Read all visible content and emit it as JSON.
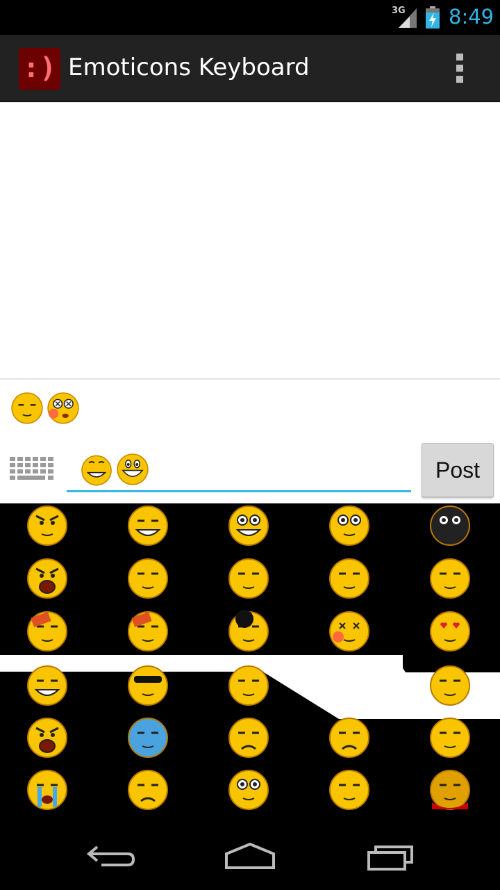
{
  "status_bar": {
    "network": "3G",
    "time": "8:49",
    "accent": "#33b5e5"
  },
  "action_bar": {
    "title": "Emoticons Keyboard",
    "icon_glyph": ":)",
    "overflow_icon": "more-vert-icon"
  },
  "preview": {
    "emoticons": [
      "sleepy-emoticon",
      "dizzy-emoticon"
    ]
  },
  "composer": {
    "input_emoticons": [
      "happy-emoticon",
      "grin-emoticon"
    ],
    "post_label": "Post",
    "keyboard_icon": "keyboard-icon"
  },
  "emoji_grid": {
    "rows": [
      [
        "angry-emoticon",
        "smirk-emoticon",
        "big-grin-emoticon",
        "shocked-emoticon",
        "dark-emoticon"
      ],
      [
        "shout-emoticon",
        "bored-emoticon",
        "confused-emoticon",
        "vomit-emoticon",
        "sleepy-emoticon"
      ],
      [
        "hit-emoticon",
        "bandaged-emoticon",
        "bomb-emoticon",
        "dizzy-emoticon",
        "in-love-emoticon"
      ],
      [
        "teeth-emoticon",
        "cool-emoticon",
        "pleading-emoticon",
        "",
        "question-emoticon"
      ],
      [
        "furious-emoticon",
        "cold-emoticon",
        "mustache-emoticon",
        "worried-emoticon",
        "text-emoticon"
      ],
      [
        "crying-emoticon",
        "frown-emoticon",
        "drooling-emoticon",
        "shy-emoticon",
        "bleeding-emoticon"
      ]
    ]
  },
  "nav_bar": {
    "buttons": [
      "back-icon",
      "home-icon",
      "recent-apps-icon"
    ]
  }
}
